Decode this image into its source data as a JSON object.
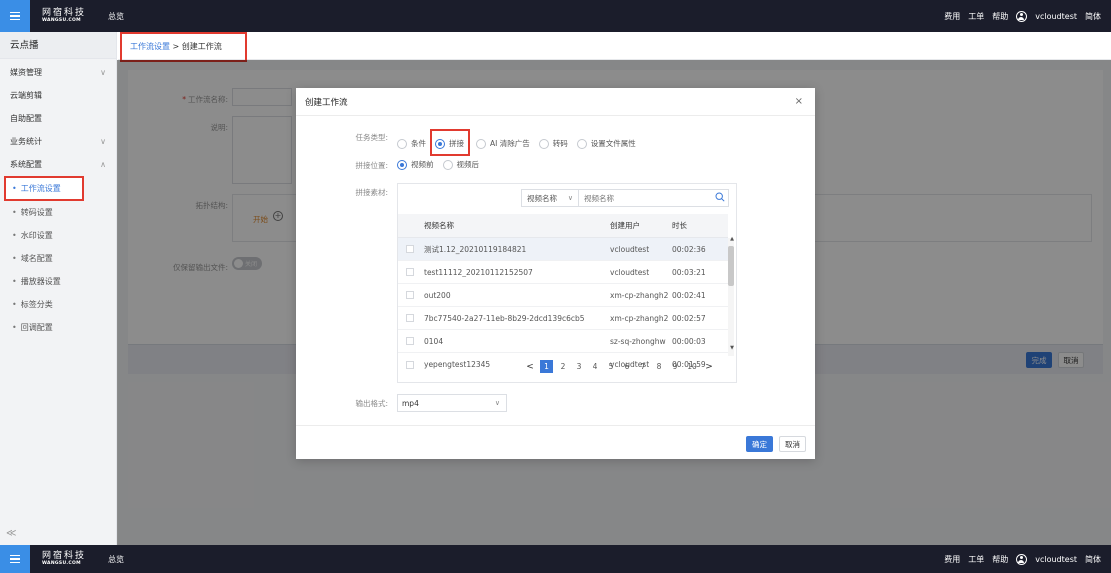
{
  "topbar": {
    "logo_cn": "网宿科技",
    "logo_en": "WANGSU.COM",
    "overview": "总览",
    "links": [
      "费用",
      "工单",
      "帮助"
    ],
    "username": "vcloudtest",
    "lang": "简体"
  },
  "sidebar": {
    "title": "云点播",
    "items": [
      {
        "label": "媒资管理",
        "chevron": "∨"
      },
      {
        "label": "云端剪辑",
        "chevron": ""
      },
      {
        "label": "自助配置",
        "chevron": ""
      },
      {
        "label": "业务统计",
        "chevron": "∨"
      },
      {
        "label": "系统配置",
        "chevron": "∧"
      }
    ],
    "subitems": [
      "工作流设置",
      "转码设置",
      "水印设置",
      "域名配置",
      "播放器设置",
      "标签分类",
      "回调配置"
    ],
    "collapse": "≪"
  },
  "breadcrumb": {
    "parent": "工作流设置",
    "sep": " > ",
    "current": "创建工作流"
  },
  "background_form": {
    "name_label": "工作流名称:",
    "desc_label": "说明:",
    "topology_label": "拓扑结构:",
    "start_label": "开始",
    "keep_output_label": "仅保留输出文件:",
    "toggle_label": "关闭",
    "finish_button": "完成",
    "cancel_button": "取消"
  },
  "modal": {
    "title": "创建工作流",
    "close": "×",
    "task_type_label": "任务类型:",
    "task_types": [
      "条件",
      "拼接",
      "AI 清除广告",
      "转码",
      "设置文件属性"
    ],
    "selected_task_type": "拼接",
    "position_label": "拼接位置:",
    "positions": [
      "视频前",
      "视频后"
    ],
    "selected_position": "视频前",
    "material_label": "拼接素材:",
    "search": {
      "field_select": "视频名称",
      "placeholder": "视频名称"
    },
    "table": {
      "headers": [
        "视频名称",
        "创建用户",
        "时长"
      ],
      "rows": [
        {
          "name": "测试1.12_20210119184821",
          "user": "vcloudtest",
          "duration": "00:02:36"
        },
        {
          "name": "test11112_20210112152507",
          "user": "vcloudtest",
          "duration": "00:03:21"
        },
        {
          "name": "out200",
          "user": "xm-cp-zhangh2",
          "duration": "00:02:41"
        },
        {
          "name": "7bc77540-2a27-11eb-8b29-2dcd139c6cb5",
          "user": "xm-cp-zhangh2",
          "duration": "00:02:57"
        },
        {
          "name": "0104",
          "user": "sz-sq-zhonghw",
          "duration": "00:00:03"
        },
        {
          "name": "yepengtest12345",
          "user": "vcloudtest",
          "duration": "00:01:59"
        }
      ]
    },
    "pager": {
      "prev": "<",
      "pages": [
        "1",
        "2",
        "3",
        "4",
        "5",
        "6",
        "7",
        "8",
        "9",
        "10"
      ],
      "current": "1",
      "next": ">"
    },
    "output_label": "输出格式:",
    "output_value": "mp4",
    "confirm": "确定",
    "cancel": "取消"
  }
}
